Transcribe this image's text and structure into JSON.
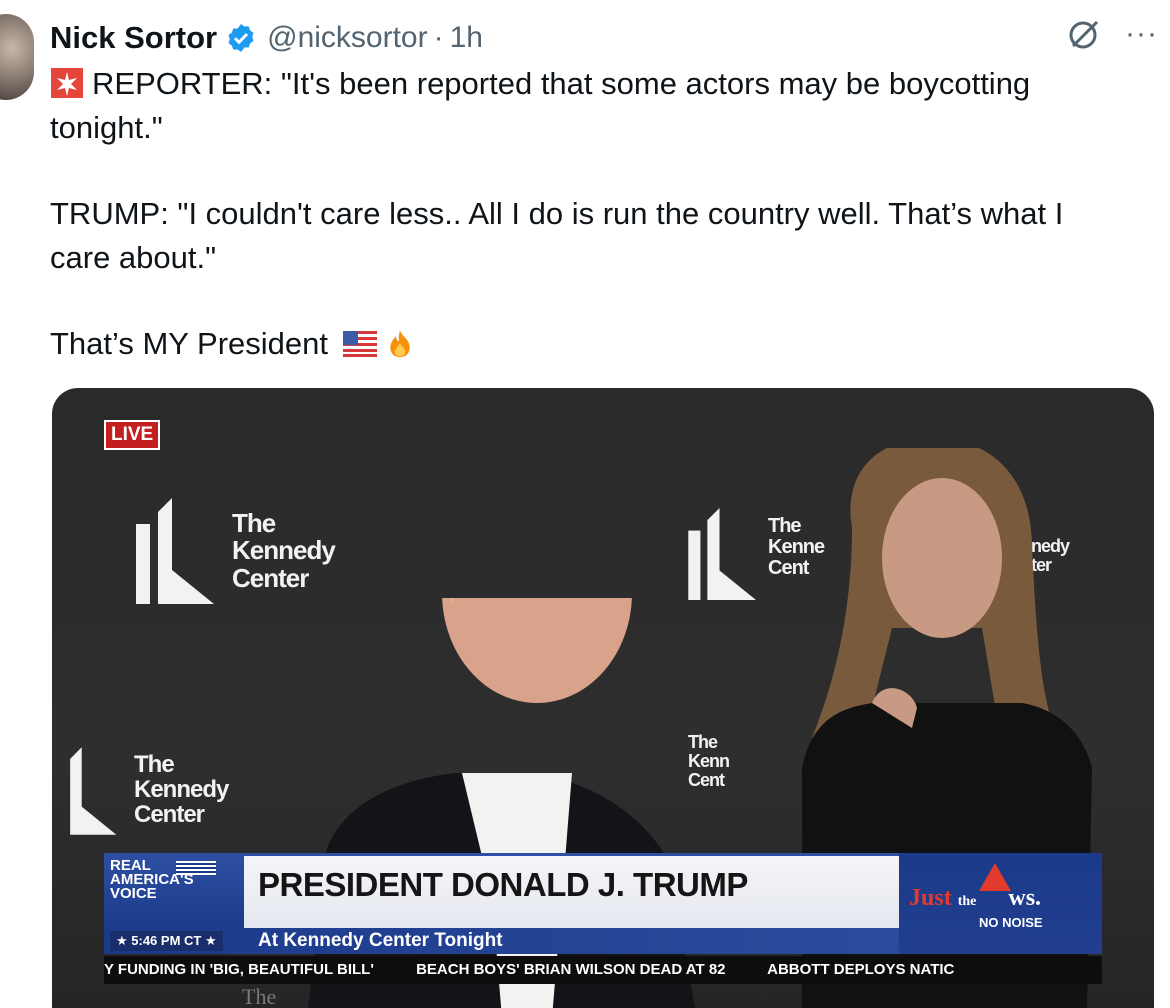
{
  "author": {
    "name": "Nick Sortor",
    "handle": "@nicksortor",
    "separator": "·",
    "time": "1h"
  },
  "header_actions": {
    "grok_icon": "grok-icon",
    "more_label": "···"
  },
  "tweet": {
    "line1": "REPORTER: \"It's been reported that some actors may be boycotting tonight.\"",
    "line2": "TRUMP: \"I couldn't care less.. All I do is run the country well. That’s what I care about.\"",
    "line3": "That’s MY President"
  },
  "media": {
    "live_badge": "LIVE",
    "logo_lines": [
      "The",
      "Kennedy",
      "Center"
    ],
    "logo_partial_1": [
      "The",
      "Kenne",
      "Cent"
    ],
    "logo_partial_2": [
      "The",
      "Kenn",
      "Cent"
    ],
    "chyron": {
      "network": "REAL AMERICA'S VOICE",
      "time": "★ 5:46 PM CT ★",
      "title": "PRESIDENT DONALD J. TRUMP",
      "subtitle": "At Kennedy Center Tonight",
      "brand_a": "Just",
      "brand_the": "the",
      "brand_b": "ws.",
      "brand_sub": "NO NOISE"
    },
    "ticker": [
      "Y FUNDING IN 'BIG, BEAUTIFUL BILL'",
      "BEACH BOYS' BRIAN WILSON DEAD AT 82",
      "ABBOTT DEPLOYS NATIC"
    ],
    "bottom_hint": "The"
  },
  "colors": {
    "verified": "#1d9bf0",
    "handle": "#536471",
    "live": "#c41e1e",
    "chyron_blue": "#1c3a8a"
  }
}
